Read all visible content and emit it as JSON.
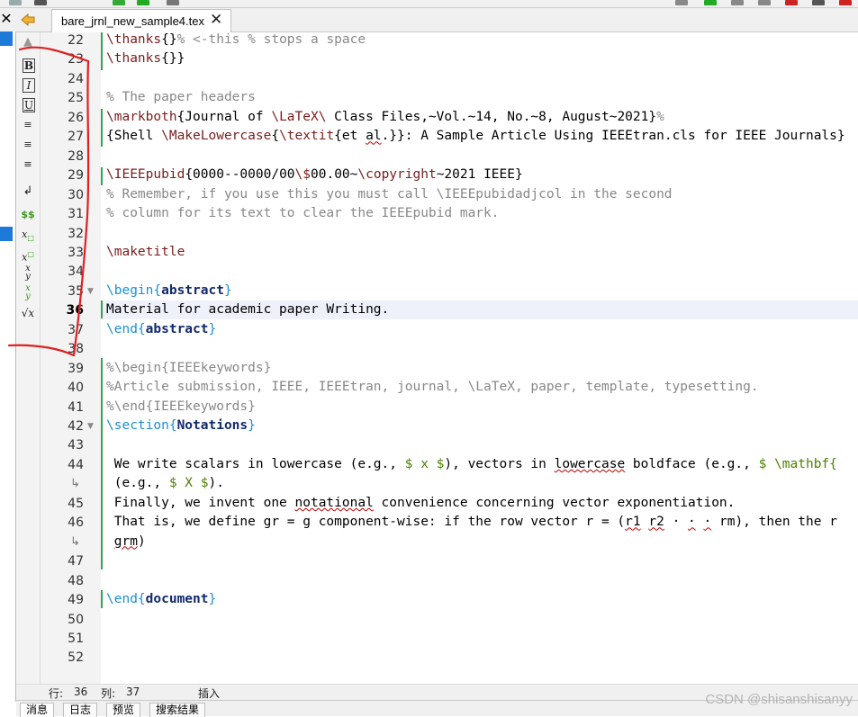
{
  "tab": {
    "filename": "bare_jrnl_new_sample4.tex",
    "close_glyph": "✕"
  },
  "left_close_glyph": "✕",
  "format_toolbar": {
    "bold": "B",
    "italic": "I",
    "underline": "U",
    "newline": "↲",
    "math_inline": "$$",
    "subscript": "x□",
    "superscript": "x□",
    "fraction": "y",
    "dfrac": "x",
    "sqrt": "√x"
  },
  "current_line": 36,
  "line_numbers": [
    22,
    23,
    24,
    25,
    26,
    27,
    28,
    29,
    30,
    31,
    32,
    33,
    34,
    35,
    36,
    37,
    38,
    39,
    40,
    41,
    42,
    43,
    44,
    "",
    45,
    46,
    "",
    47,
    48,
    49,
    50,
    51,
    52
  ],
  "editor_lines": [
    {
      "n": "22",
      "segments": [
        [
          "cmd",
          "\\thanks"
        ],
        [
          "",
          "{}"
        ],
        [
          "cmt",
          "% <-this % stops a space"
        ]
      ]
    },
    {
      "n": "23",
      "segments": [
        [
          "cmd",
          "\\thanks"
        ],
        [
          "",
          "{}}"
        ]
      ]
    },
    {
      "n": "24",
      "segments": []
    },
    {
      "n": "25",
      "segments": [
        [
          "cmt",
          "% The paper headers"
        ]
      ]
    },
    {
      "n": "26",
      "segments": [
        [
          "cmd",
          "\\markboth"
        ],
        [
          "",
          "{Journal of "
        ],
        [
          "cmd",
          "\\LaTeX\\"
        ],
        [
          "",
          " Class Files,~Vol.~14, No.~8, August~2021}"
        ],
        [
          "cmt",
          "%"
        ]
      ]
    },
    {
      "n": "27",
      "segments": [
        [
          "",
          "{Shell "
        ],
        [
          "cmd",
          "\\MakeLowercase"
        ],
        [
          "",
          "{"
        ],
        [
          "cmd",
          "\\textit"
        ],
        [
          "",
          "{et "
        ],
        [
          "spell",
          "al"
        ],
        [
          "",
          ".}}: A Sample Article Using IEEEtran.cls for IEEE Journals}"
        ]
      ]
    },
    {
      "n": "28",
      "segments": []
    },
    {
      "n": "29",
      "segments": [
        [
          "cmd",
          "\\IEEEpubid"
        ],
        [
          "",
          "{0000--0000/00"
        ],
        [
          "cmd",
          "\\$"
        ],
        [
          "",
          "00.00~"
        ],
        [
          "cmd",
          "\\copyright"
        ],
        [
          "",
          "~2021 IEEE}"
        ]
      ]
    },
    {
      "n": "30",
      "segments": [
        [
          "cmt",
          "% Remember, if you use this you must call \\IEEEpubidadjcol in the second"
        ]
      ]
    },
    {
      "n": "31",
      "segments": [
        [
          "cmt",
          "% column for its text to clear the IEEEpubid mark."
        ]
      ]
    },
    {
      "n": "32",
      "segments": []
    },
    {
      "n": "33",
      "segments": [
        [
          "cmd",
          "\\maketitle"
        ]
      ]
    },
    {
      "n": "34",
      "segments": []
    },
    {
      "n": "35",
      "segments": [
        [
          "kw",
          "\\begin{"
        ],
        [
          "env",
          "abstract"
        ],
        [
          "kw",
          "}"
        ]
      ]
    },
    {
      "n": "36",
      "segments": [
        [
          "",
          "Material for academic paper Writing."
        ]
      ]
    },
    {
      "n": "37",
      "segments": [
        [
          "kw",
          "\\end{"
        ],
        [
          "env",
          "abstract"
        ],
        [
          "kw",
          "}"
        ]
      ]
    },
    {
      "n": "38",
      "segments": []
    },
    {
      "n": "39",
      "segments": [
        [
          "cmt",
          "%\\begin{IEEEkeywords}"
        ]
      ]
    },
    {
      "n": "40",
      "segments": [
        [
          "cmt",
          "%Article submission, IEEE, IEEEtran, journal, \\LaTeX, paper, template, typesetting."
        ]
      ]
    },
    {
      "n": "41",
      "segments": [
        [
          "cmt",
          "%\\end{IEEEkeywords}"
        ]
      ]
    },
    {
      "n": "42",
      "segments": [
        [
          "kw",
          "\\section{"
        ],
        [
          "env2",
          "Notations"
        ],
        [
          "kw",
          "}"
        ]
      ]
    },
    {
      "n": "43",
      "segments": []
    },
    {
      "n": "44",
      "segments": [
        [
          "",
          " We write scalars in lowercase (e.g., "
        ],
        [
          "math",
          "$ x $"
        ],
        [
          "",
          "), vectors in "
        ],
        [
          "spell",
          "lowercase"
        ],
        [
          "",
          " boldface (e.g., "
        ],
        [
          "math",
          "$ \\mathbf{"
        ]
      ]
    },
    {
      "n": "",
      "segments": [
        [
          "",
          " (e.g., "
        ],
        [
          "math",
          "$ X $"
        ],
        [
          "",
          ")."
        ]
      ]
    },
    {
      "n": "45",
      "segments": [
        [
          "",
          " Finally, we invent one "
        ],
        [
          "spell",
          "notational"
        ],
        [
          "",
          " convenience concerning vector exponentiation."
        ]
      ]
    },
    {
      "n": "46",
      "segments": [
        [
          "",
          " That is, we define gr = g component-wise: if the row vector r = ("
        ],
        [
          "spell",
          "r1"
        ],
        [
          "",
          " "
        ],
        [
          "spell",
          "r2"
        ],
        [
          "",
          " · "
        ],
        [
          "spell",
          "·"
        ],
        [
          "",
          " "
        ],
        [
          "spell",
          "·"
        ],
        [
          "",
          " rm), then the r"
        ]
      ]
    },
    {
      "n": "",
      "segments": [
        [
          "",
          " "
        ],
        [
          "spell",
          "grm"
        ],
        [
          "",
          ")"
        ]
      ]
    },
    {
      "n": "47",
      "segments": []
    },
    {
      "n": "48",
      "segments": []
    },
    {
      "n": "49",
      "segments": [
        [
          "kw",
          "\\end{"
        ],
        [
          "env",
          "document"
        ],
        [
          "kw",
          "}"
        ]
      ]
    },
    {
      "n": "50",
      "segments": []
    },
    {
      "n": "51",
      "segments": []
    },
    {
      "n": "52",
      "segments": []
    }
  ],
  "status": {
    "row_label": "行:",
    "row_value": "36",
    "col_label": "列:",
    "col_value": "37",
    "mode": "插入"
  },
  "bottom_tabs": [
    "消息",
    "日志",
    "预览",
    "搜索结果"
  ],
  "watermark": "CSDN @shisanshisanyy",
  "colors": {
    "annotation": "#e02020",
    "change_marker": "#2fa84a",
    "accent": "#1e7ad8"
  }
}
